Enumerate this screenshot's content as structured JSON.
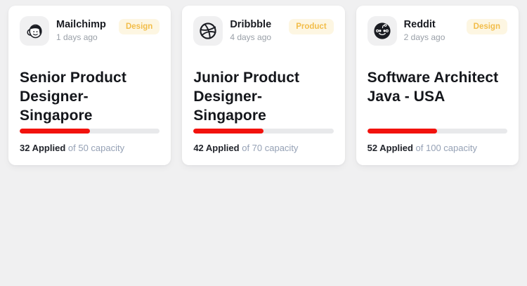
{
  "colors": {
    "page_background": "#f0f0f1",
    "card_background": "#ffffff",
    "progress_red": "#f2120d",
    "progress_track": "#e8e9eb",
    "badge_text": "#f2bd4a",
    "badge_background": "#fdf6e2",
    "capacity_text": "#95a1b5"
  },
  "cards": [
    {
      "company": "Mailchimp",
      "icon": "mailchimp-icon",
      "posted": "1 days ago",
      "tag": "Design",
      "title": "Senior Product Designer-Singapore",
      "applied": 32,
      "capacity": 50,
      "applied_label": "32 Applied",
      "capacity_label": "of 50 capacity",
      "progress_percent": 50
    },
    {
      "company": "Dribbble",
      "icon": "dribbble-icon",
      "posted": "4 days ago",
      "tag": "Product",
      "title": "Junior Product Designer-Singapore",
      "applied": 42,
      "capacity": 70,
      "applied_label": "42 Applied",
      "capacity_label": "of 70 capacity",
      "progress_percent": 50
    },
    {
      "company": "Reddit",
      "icon": "reddit-icon",
      "posted": "2 days ago",
      "tag": "Design",
      "title": "Software Architect Java - USA",
      "applied": 52,
      "capacity": 100,
      "applied_label": "52 Applied",
      "capacity_label": "of 100 capacity",
      "progress_percent": 50
    }
  ]
}
